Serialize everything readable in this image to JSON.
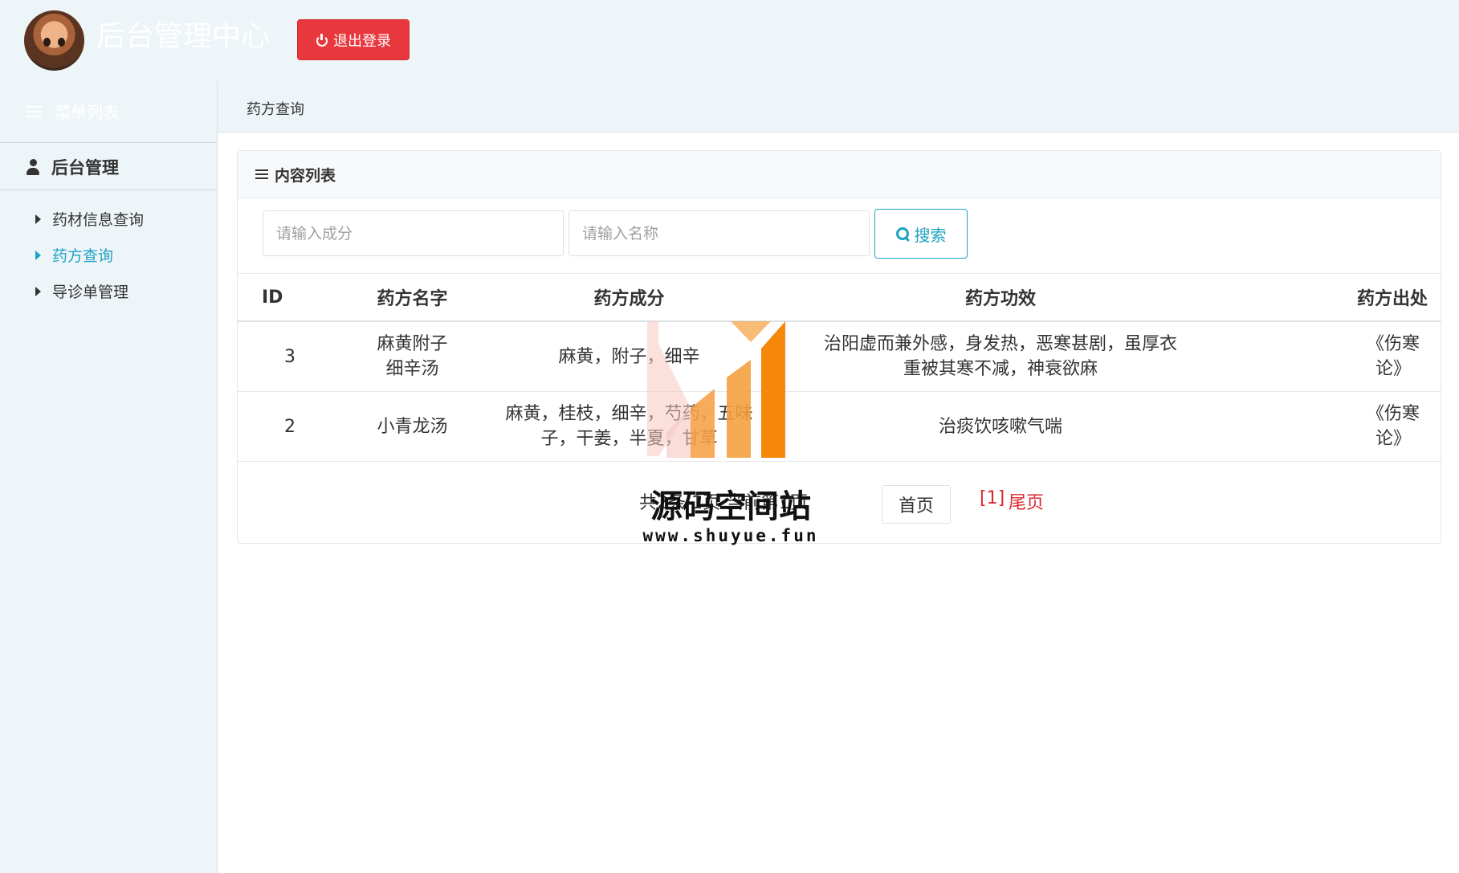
{
  "header": {
    "site_title": "后台管理中心",
    "logout_label": "退出登录"
  },
  "sidebar": {
    "menu_title": "菜单列表",
    "group_label": "后台管理",
    "items": [
      {
        "label": "药材信息查询",
        "active": false
      },
      {
        "label": "药方查询",
        "active": true
      },
      {
        "label": "导诊单管理",
        "active": false
      }
    ]
  },
  "breadcrumb": "药方查询",
  "panel": {
    "title": "内容列表"
  },
  "search": {
    "ingredient_placeholder": "请输入成分",
    "name_placeholder": "请输入名称",
    "button_label": "搜索"
  },
  "table": {
    "headers": [
      "ID",
      "药方名字",
      "药方成分",
      "药方功效",
      "药方出处"
    ],
    "rows": [
      [
        "3",
        "麻黄附子细辛汤",
        "麻黄，附子，细辛",
        "治阳虚而兼外感，身发热，恶寒甚剧，虽厚衣重被其寒不减，神衰欲麻",
        "《伤寒论》"
      ],
      [
        "2",
        "小青龙汤",
        "麻黄，桂枝，细辛，芍药，五味子，干姜，半夏，甘草",
        "治痰饮咳嗽气喘",
        "《伤寒论》"
      ]
    ]
  },
  "pager": {
    "info": "共2条 1页 当前第1页",
    "first_label": "首页",
    "current_label": "[1]",
    "last_label": "尾页"
  },
  "watermark": {
    "name": "源码空间站",
    "url": "www.shuyue.fun"
  },
  "colors": {
    "accent": "#1fa3c2",
    "danger": "#e8383d",
    "pager_red": "#d9282f",
    "watermark_orange": "#f5870a"
  }
}
